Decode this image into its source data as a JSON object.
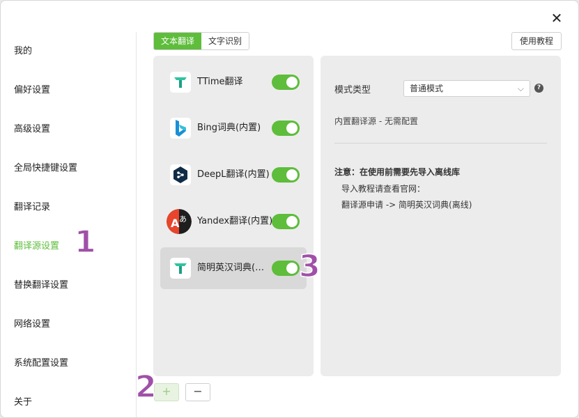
{
  "window": {
    "close_glyph": "✕"
  },
  "sidebar": {
    "items": [
      {
        "label": "我的",
        "active": false
      },
      {
        "label": "偏好设置",
        "active": false
      },
      {
        "label": "高级设置",
        "active": false
      },
      {
        "label": "全局快捷键设置",
        "active": false
      },
      {
        "label": "翻译记录",
        "active": false
      },
      {
        "label": "翻译源设置",
        "active": true
      },
      {
        "label": "替换翻译设置",
        "active": false
      },
      {
        "label": "网络设置",
        "active": false
      },
      {
        "label": "系统配置设置",
        "active": false
      },
      {
        "label": "关于",
        "active": false
      }
    ]
  },
  "tabs": [
    {
      "label": "文本翻译",
      "active": true
    },
    {
      "label": "文字识别",
      "active": false
    }
  ],
  "help_button": "使用教程",
  "sources": [
    {
      "name": "TTime翻译",
      "icon": "ttime-icon",
      "enabled": true,
      "selected": false
    },
    {
      "name": "Bing词典(内置)",
      "icon": "bing-icon",
      "enabled": true,
      "selected": false
    },
    {
      "name": "DeepL翻译(内置)",
      "icon": "deepl-icon",
      "enabled": true,
      "selected": false
    },
    {
      "name": "Yandex翻译(内置)",
      "icon": "yandex-icon",
      "enabled": true,
      "selected": false
    },
    {
      "name": "简明英汉词典(内置)",
      "icon": "ttime-icon",
      "enabled": true,
      "selected": true
    }
  ],
  "detail": {
    "mode_label": "模式类型",
    "mode_value": "普通模式",
    "builtin_text": "内置翻译源 - 无需配置",
    "note_title": "注意：在使用前需要先导入离线库",
    "note_line1": "导入教程请查看官网：",
    "note_line2": "翻译源申请 -> 简明英汉词典(离线)"
  },
  "bottom": {
    "add_label": "+",
    "remove_label": "−"
  },
  "markers": [
    "1",
    "2",
    "3"
  ],
  "colors": {
    "accent": "#5ebd3b",
    "marker": "#a050a8"
  }
}
